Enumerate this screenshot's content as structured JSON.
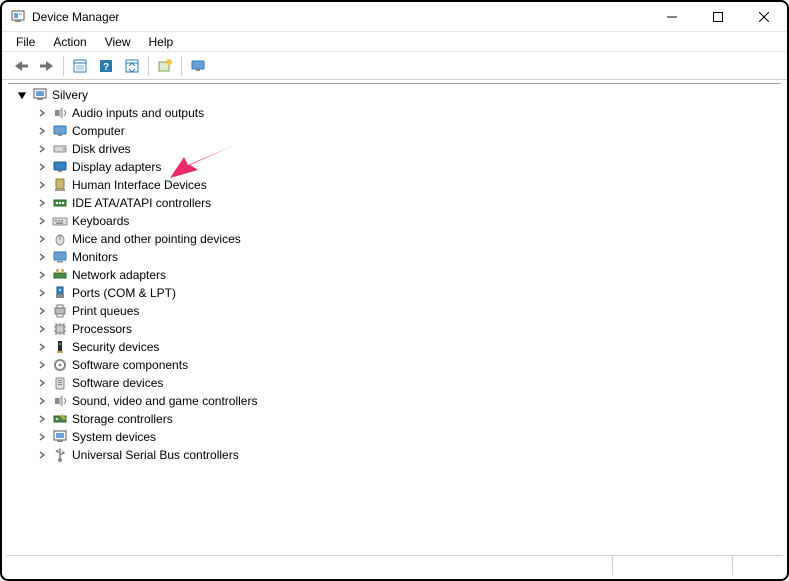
{
  "window": {
    "title": "Device Manager"
  },
  "menu": {
    "file": "File",
    "action": "Action",
    "view": "View",
    "help": "Help"
  },
  "tree": {
    "root": "Silvery",
    "items": [
      {
        "id": "audio",
        "label": "Audio inputs and outputs"
      },
      {
        "id": "computer",
        "label": "Computer"
      },
      {
        "id": "disk",
        "label": "Disk drives"
      },
      {
        "id": "display",
        "label": "Display adapters"
      },
      {
        "id": "hid",
        "label": "Human Interface Devices"
      },
      {
        "id": "ide",
        "label": "IDE ATA/ATAPI controllers"
      },
      {
        "id": "keyboards",
        "label": "Keyboards"
      },
      {
        "id": "mice",
        "label": "Mice and other pointing devices"
      },
      {
        "id": "monitors",
        "label": "Monitors"
      },
      {
        "id": "network",
        "label": "Network adapters"
      },
      {
        "id": "ports",
        "label": "Ports (COM & LPT)"
      },
      {
        "id": "printq",
        "label": "Print queues"
      },
      {
        "id": "processors",
        "label": "Processors"
      },
      {
        "id": "security",
        "label": "Security devices"
      },
      {
        "id": "softcomp",
        "label": "Software components"
      },
      {
        "id": "softdev",
        "label": "Software devices"
      },
      {
        "id": "sound",
        "label": "Sound, video and game controllers"
      },
      {
        "id": "storage",
        "label": "Storage controllers"
      },
      {
        "id": "system",
        "label": "System devices"
      },
      {
        "id": "usb",
        "label": "Universal Serial Bus controllers"
      }
    ]
  },
  "annotation": {
    "target_id": "display",
    "color": "#e91e63"
  }
}
